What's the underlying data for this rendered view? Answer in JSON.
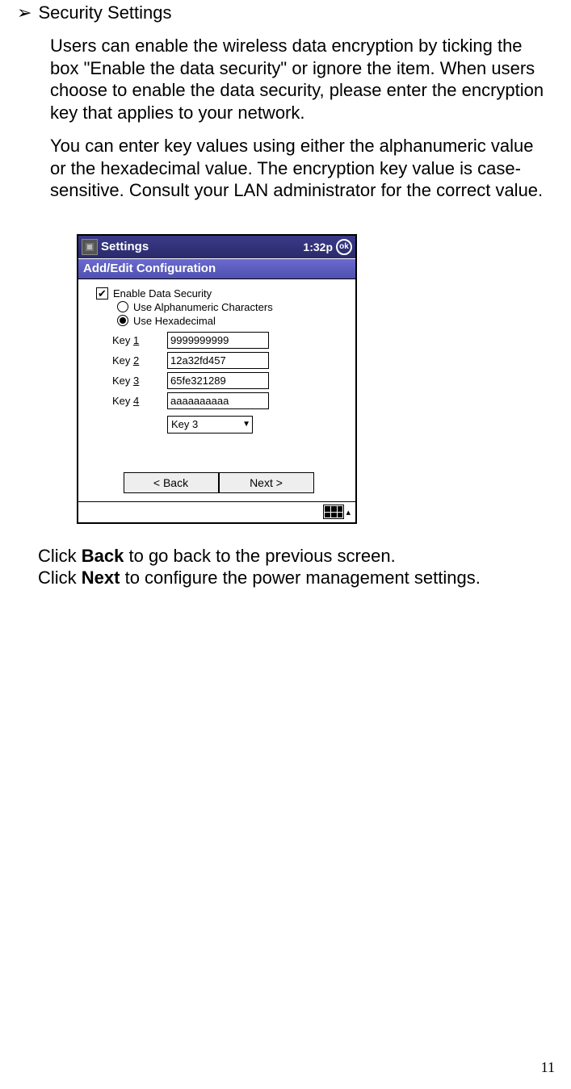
{
  "bullet_glyph": "➢",
  "heading": "Security Settings",
  "para1": "Users can enable the wireless data encryption by ticking the box \"Enable the data security\" or ignore the item. When users choose to enable the data security, please enter the encryption key that applies to your network.",
  "para2": "You can enter key values using either the alphanumeric value or the hexadecimal value. The encryption key value is case-sensitive. Consult your LAN administrator for the correct value.",
  "screenshot": {
    "title": "Settings",
    "time": "1:32p",
    "ok": "ok",
    "subtitle": "Add/Edit Configuration",
    "checkbox_label": "Enable Data Security",
    "radio_alpha": "Use Alphanumeric Characters",
    "radio_hex": "Use Hexadecimal",
    "keys": [
      {
        "label_pre": "Key ",
        "label_u": "1",
        "value": "9999999999"
      },
      {
        "label_pre": "Key ",
        "label_u": "2",
        "value": "12a32fd457"
      },
      {
        "label_pre": "Key ",
        "label_u": "3",
        "value": "65fe321289"
      },
      {
        "label_pre": "Key ",
        "label_u": "4",
        "value": "aaaaaaaaaa"
      }
    ],
    "select_value": "Key 3",
    "back_btn": "< Back",
    "next_btn": "Next >"
  },
  "click_back_pre": "Click ",
  "click_back_bold": "Back",
  "click_back_post": " to go back to the previous screen.",
  "click_next_pre": "Click ",
  "click_next_bold": "Next",
  "click_next_post": " to configure the power management settings.",
  "page_num": "11"
}
